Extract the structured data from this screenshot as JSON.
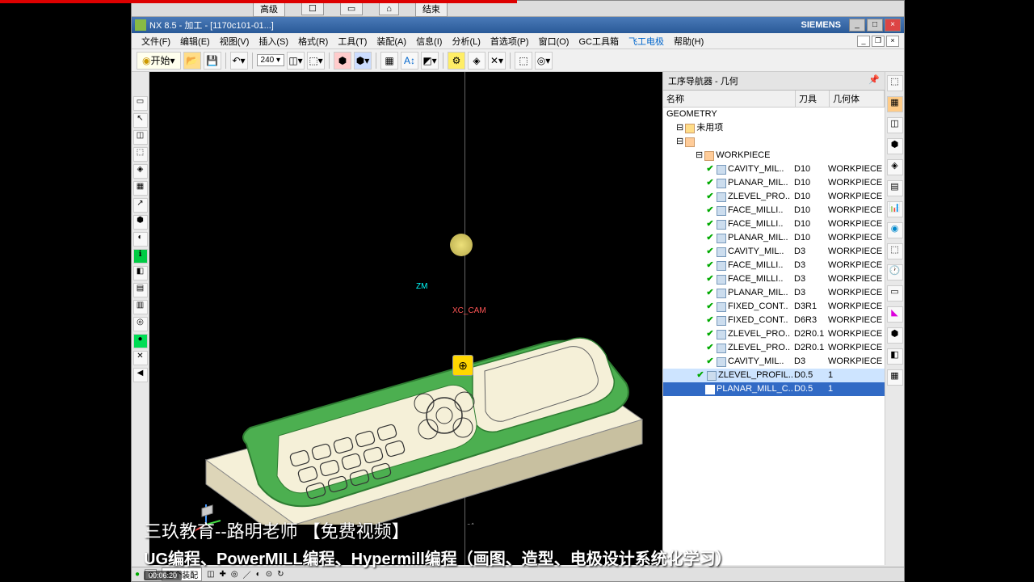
{
  "titlebar": {
    "app": "NX 8.5 - 加工 - [1170c101-01...]",
    "brand": "SIEMENS"
  },
  "sec_bar": {
    "b1": "高级",
    "b2": "结束"
  },
  "menu": {
    "items": [
      "文件(F)",
      "编辑(E)",
      "视图(V)",
      "插入(S)",
      "格式(R)",
      "工具(T)",
      "装配(A)",
      "信息(I)",
      "分析(L)",
      "首选项(P)",
      "窗口(O)",
      "GC工具箱",
      "飞工电极",
      "帮助(H)"
    ]
  },
  "toolbar": {
    "start": "开始",
    "zoom": "240"
  },
  "nav": {
    "title": "工序导航器 - 几何",
    "cols": {
      "name": "名称",
      "tool": "刀具",
      "geom": "几何体"
    },
    "root": "GEOMETRY",
    "unused": "未用项",
    "workpiece": "WORKPIECE",
    "ops": [
      {
        "n": "CAVITY_MIL..",
        "t": "D10",
        "g": "WORKPIECE"
      },
      {
        "n": "PLANAR_MIL..",
        "t": "D10",
        "g": "WORKPIECE"
      },
      {
        "n": "ZLEVEL_PRO..",
        "t": "D10",
        "g": "WORKPIECE"
      },
      {
        "n": "FACE_MILLI..",
        "t": "D10",
        "g": "WORKPIECE"
      },
      {
        "n": "FACE_MILLI..",
        "t": "D10",
        "g": "WORKPIECE"
      },
      {
        "n": "PLANAR_MIL..",
        "t": "D10",
        "g": "WORKPIECE"
      },
      {
        "n": "CAVITY_MIL..",
        "t": "D3",
        "g": "WORKPIECE"
      },
      {
        "n": "FACE_MILLI..",
        "t": "D3",
        "g": "WORKPIECE"
      },
      {
        "n": "FACE_MILLI..",
        "t": "D3",
        "g": "WORKPIECE"
      },
      {
        "n": "PLANAR_MIL..",
        "t": "D3",
        "g": "WORKPIECE"
      },
      {
        "n": "FIXED_CONT..",
        "t": "D3R1",
        "g": "WORKPIECE"
      },
      {
        "n": "FIXED_CONT..",
        "t": "D6R3",
        "g": "WORKPIECE"
      },
      {
        "n": "ZLEVEL_PRO..",
        "t": "D2R0.1",
        "g": "WORKPIECE"
      },
      {
        "n": "ZLEVEL_PRO..",
        "t": "D2R0.1",
        "g": "WORKPIECE"
      },
      {
        "n": "CAVITY_MIL..",
        "t": "D3",
        "g": "WORKPIECE"
      }
    ],
    "sel_prev": {
      "n": "ZLEVEL_PROFIL..",
      "t": "D0.5",
      "g": "1"
    },
    "selected": {
      "n": "PLANAR_MILL_C..",
      "t": "D0.5",
      "g": "1"
    }
  },
  "triad": {
    "zm": "ZM",
    "xc": "XC_CAM"
  },
  "statusbar": {
    "filter": "整个装配"
  },
  "overlay": {
    "line1": "三玖教育--路明老师   【免费视频】",
    "line2": "UG编程、PowerMILL编程、Hypermill编程（画图、造型、电极设计系统化学习）"
  },
  "video": {
    "time": "00:06:20"
  }
}
